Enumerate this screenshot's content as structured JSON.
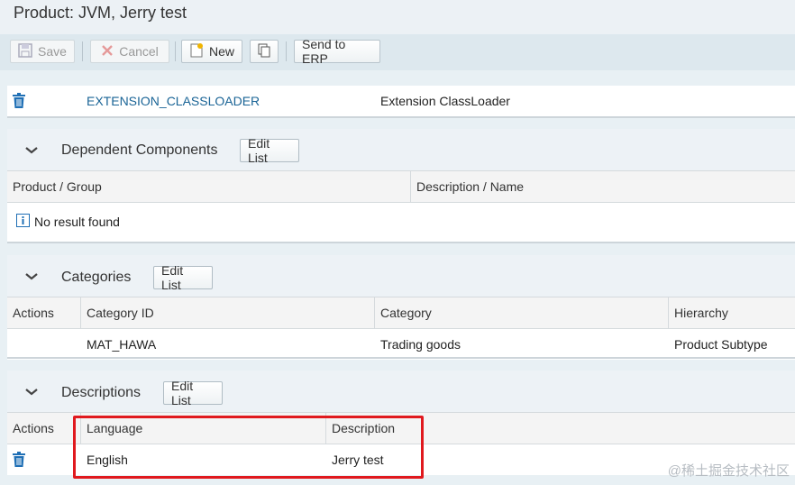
{
  "page": {
    "title": "Product: JVM, Jerry test"
  },
  "toolbar": {
    "save_label": "Save",
    "cancel_label": "Cancel",
    "new_label": "New",
    "send_label": "Send to ERP"
  },
  "extension_row": {
    "id": "EXTENSION_CLASSLOADER",
    "name": "Extension ClassLoader"
  },
  "dependent": {
    "title": "Dependent Components",
    "edit_label": "Edit List",
    "columns": [
      "Product / Group",
      "Description / Name"
    ],
    "empty_text": "No result found"
  },
  "categories": {
    "title": "Categories",
    "edit_label": "Edit List",
    "columns": [
      "Actions",
      "Category ID",
      "Category",
      "Hierarchy"
    ],
    "rows": [
      {
        "id": "MAT_HAWA",
        "category": "Trading goods",
        "hierarchy": "Product Subtype"
      }
    ]
  },
  "descriptions": {
    "title": "Descriptions",
    "edit_label": "Edit List",
    "columns": [
      "Actions",
      "Language",
      "Description"
    ],
    "rows": [
      {
        "language": "English",
        "description": "Jerry test"
      }
    ]
  },
  "watermark": "@稀土掘金技术社区",
  "colors": {
    "link": "#1a6496",
    "icon_blue": "#1f6fb5",
    "highlight": "#e0191e"
  }
}
